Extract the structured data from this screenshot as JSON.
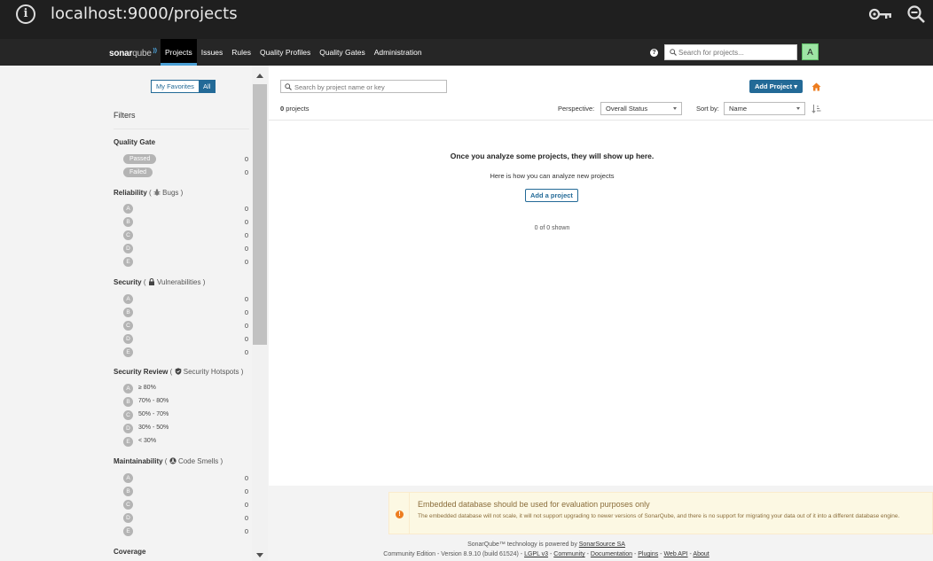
{
  "browser": {
    "url": "localhost:9000/projects",
    "info_icon": "i"
  },
  "nav": {
    "logo_bold": "sonar",
    "logo_light": "qube",
    "menu": [
      "Projects",
      "Issues",
      "Rules",
      "Quality Profiles",
      "Quality Gates",
      "Administration"
    ],
    "help_icon": "?",
    "search_placeholder": "Search for projects...",
    "avatar_letter": "A"
  },
  "sidebar": {
    "toggle": [
      "My Favorites",
      "All"
    ],
    "filters_title": "Filters",
    "quality_gate": {
      "title": "Quality Gate",
      "items": [
        {
          "label": "Passed",
          "count": "0"
        },
        {
          "label": "Failed",
          "count": "0"
        }
      ]
    },
    "reliability": {
      "title": "Reliability",
      "open": "(",
      "sub": "Bugs",
      "close": ")",
      "items": [
        {
          "grade": "A",
          "count": "0"
        },
        {
          "grade": "B",
          "count": "0"
        },
        {
          "grade": "C",
          "count": "0"
        },
        {
          "grade": "D",
          "count": "0"
        },
        {
          "grade": "E",
          "count": "0"
        }
      ]
    },
    "security": {
      "title": "Security",
      "open": "(",
      "sub": "Vulnerabilities",
      "close": ")",
      "items": [
        {
          "grade": "A",
          "count": "0"
        },
        {
          "grade": "B",
          "count": "0"
        },
        {
          "grade": "C",
          "count": "0"
        },
        {
          "grade": "D",
          "count": "0"
        },
        {
          "grade": "E",
          "count": "0"
        }
      ]
    },
    "security_review": {
      "title": "Security Review",
      "open": "(",
      "sub": "Security Hotspots",
      "close": ")",
      "items": [
        {
          "grade": "A",
          "label": "≥ 80%"
        },
        {
          "grade": "B",
          "label": "70% - 80%"
        },
        {
          "grade": "C",
          "label": "50% - 70%"
        },
        {
          "grade": "D",
          "label": "30% - 50%"
        },
        {
          "grade": "E",
          "label": "< 30%"
        }
      ]
    },
    "maintainability": {
      "title": "Maintainability",
      "open": "(",
      "sub": "Code Smells",
      "close": ")",
      "items": [
        {
          "grade": "A",
          "count": "0"
        },
        {
          "grade": "B",
          "count": "0"
        },
        {
          "grade": "C",
          "count": "0"
        },
        {
          "grade": "D",
          "count": "0"
        },
        {
          "grade": "E",
          "count": "0"
        }
      ]
    },
    "coverage_title": "Coverage"
  },
  "main": {
    "search_placeholder": "Search by project name or key",
    "add_project": "Add Project",
    "add_project_caret": "▾",
    "project_count": "0",
    "project_count_label": "projects",
    "perspective_label": "Perspective:",
    "perspective_value": "Overall Status",
    "sortby_label": "Sort by:",
    "sortby_value": "Name",
    "empty_title": "Once you analyze some projects, they will show up here.",
    "empty_sub": "Here is how you can analyze new projects",
    "add_a_project": "Add a project",
    "shown": "0 of 0 shown"
  },
  "warning": {
    "icon": "!",
    "title": "Embedded database should be used for evaluation purposes only",
    "body": "The embedded database will not scale, it will not support upgrading to newer versions of SonarQube, and there is no support for migrating your data out of it into a different database engine."
  },
  "footer": {
    "line1_prefix": "SonarQube™ technology is powered by ",
    "line1_link": "SonarSource SA",
    "edition": "Community Edition",
    "version": "Version 8.9.10 (build 61524)",
    "license": "LGPL v3",
    "community": "Community",
    "documentation": "Documentation",
    "plugins": "Plugins",
    "webapi": "Web API",
    "about": "About",
    "sep": " - "
  },
  "colors": {
    "accent": "#236a97",
    "nav_bg": "#262626",
    "warning_bg": "#fcf8e3",
    "home_icon": "#ed7d20",
    "avatar_bg": "#9ee4a4"
  }
}
